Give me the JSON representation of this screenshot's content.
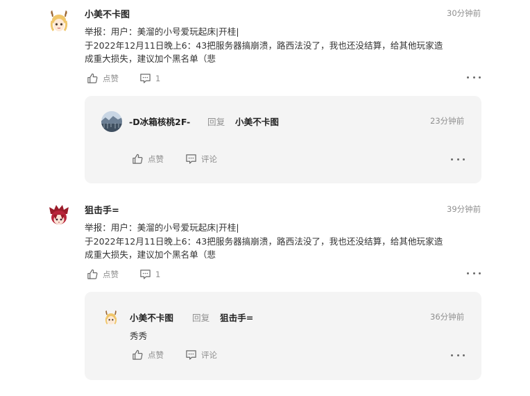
{
  "comments": [
    {
      "username": "小美不卡图",
      "time": "30分钟前",
      "content_lines": [
        "举报：用户：美溜的小号爱玩起床|开桂|",
        "于2022年12月11日晚上6：43把服务器搞崩溃，路西法没了，我也还没结算，给其他玩家造",
        "成重大损失，建议加个黑名单（悲"
      ],
      "like_label": "点赞",
      "reply_count": "1",
      "reply": {
        "username": "-D冰箱核桃2F-",
        "reply_word": "回复",
        "target": "小美不卡图",
        "time": "23分钟前",
        "text": "",
        "like_label": "点赞",
        "comment_label": "评论"
      }
    },
    {
      "username": "狙击手=",
      "time": "39分钟前",
      "content_lines": [
        "举报：用户：美溜的小号爱玩起床|开桂|",
        "于2022年12月11日晚上6：43把服务器搞崩溃，路西法没了，我也还没结算，给其他玩家造",
        "成重大损失，建议加个黑名单（悲"
      ],
      "like_label": "点赞",
      "reply_count": "1",
      "reply": {
        "username": "小美不卡图",
        "reply_word": "回复",
        "target": "狙击手=",
        "time": "36分钟前",
        "text": "秀秀",
        "like_label": "点赞",
        "comment_label": "评论"
      }
    }
  ],
  "icons": {
    "like": "thumbs-up-icon",
    "comment": "comment-bubble-icon",
    "more": "more-dots-icon"
  },
  "colors": {
    "reply_box_bg": "#f4f4f4",
    "muted_text": "#8f8f8f",
    "username_text": "#222222"
  }
}
